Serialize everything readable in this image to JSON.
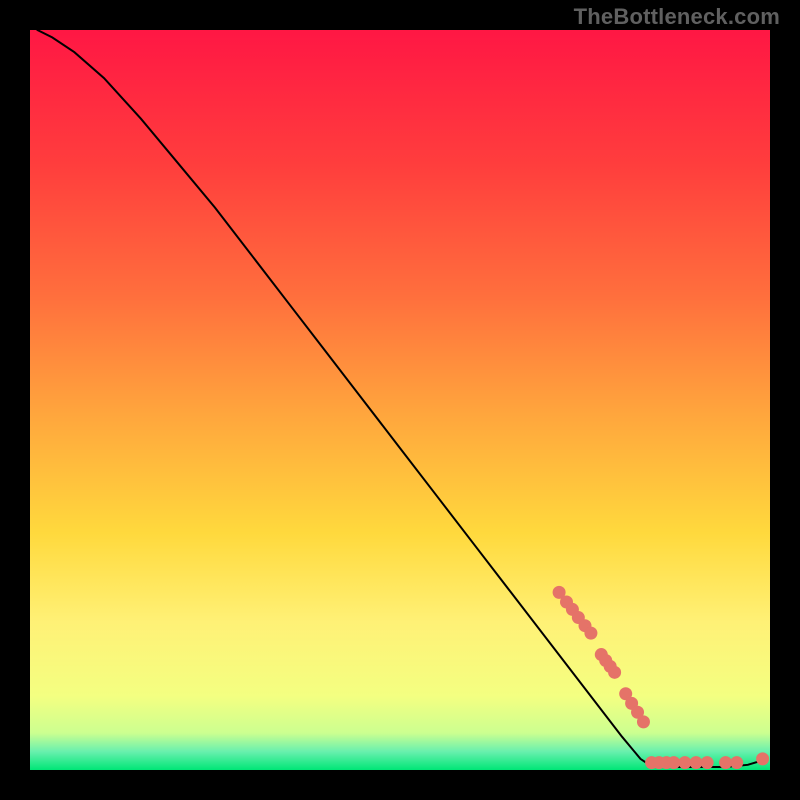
{
  "watermark": "TheBottleneck.com",
  "chart_data": {
    "type": "line",
    "title": "",
    "xlabel": "",
    "ylabel": "",
    "xlim": [
      0,
      100
    ],
    "ylim": [
      0,
      100
    ],
    "grid": false,
    "legend": false,
    "gradient_stops": [
      {
        "offset": 0.0,
        "color": "#ff1744"
      },
      {
        "offset": 0.18,
        "color": "#ff3d3d"
      },
      {
        "offset": 0.36,
        "color": "#ff6f3d"
      },
      {
        "offset": 0.52,
        "color": "#ffa63d"
      },
      {
        "offset": 0.68,
        "color": "#ffd93d"
      },
      {
        "offset": 0.8,
        "color": "#fff176"
      },
      {
        "offset": 0.9,
        "color": "#f4ff81"
      },
      {
        "offset": 0.95,
        "color": "#ccff90"
      },
      {
        "offset": 0.975,
        "color": "#69f0ae"
      },
      {
        "offset": 1.0,
        "color": "#00e676"
      }
    ],
    "series": [
      {
        "name": "curve",
        "type": "line",
        "style": "black-thin",
        "points": [
          {
            "x": 1.0,
            "y": 100.0
          },
          {
            "x": 3.0,
            "y": 99.0
          },
          {
            "x": 6.0,
            "y": 97.0
          },
          {
            "x": 10.0,
            "y": 93.5
          },
          {
            "x": 15.0,
            "y": 88.0
          },
          {
            "x": 20.0,
            "y": 82.0
          },
          {
            "x": 25.0,
            "y": 76.0
          },
          {
            "x": 30.0,
            "y": 69.5
          },
          {
            "x": 35.0,
            "y": 63.0
          },
          {
            "x": 40.0,
            "y": 56.5
          },
          {
            "x": 45.0,
            "y": 50.0
          },
          {
            "x": 50.0,
            "y": 43.5
          },
          {
            "x": 55.0,
            "y": 37.0
          },
          {
            "x": 60.0,
            "y": 30.5
          },
          {
            "x": 65.0,
            "y": 24.0
          },
          {
            "x": 70.0,
            "y": 17.5
          },
          {
            "x": 75.0,
            "y": 11.0
          },
          {
            "x": 80.0,
            "y": 4.5
          },
          {
            "x": 82.5,
            "y": 1.5
          },
          {
            "x": 84.0,
            "y": 0.5
          },
          {
            "x": 86.0,
            "y": 0.4
          },
          {
            "x": 90.0,
            "y": 0.4
          },
          {
            "x": 94.0,
            "y": 0.4
          },
          {
            "x": 97.0,
            "y": 0.7
          },
          {
            "x": 99.0,
            "y": 1.3
          }
        ]
      },
      {
        "name": "highlight-dots",
        "type": "scatter",
        "style": "coral-dot",
        "points": [
          {
            "x": 71.5,
            "y": 24.0
          },
          {
            "x": 72.5,
            "y": 22.7
          },
          {
            "x": 73.3,
            "y": 21.7
          },
          {
            "x": 74.1,
            "y": 20.6
          },
          {
            "x": 75.0,
            "y": 19.5
          },
          {
            "x": 75.8,
            "y": 18.5
          },
          {
            "x": 77.2,
            "y": 15.6
          },
          {
            "x": 77.8,
            "y": 14.8
          },
          {
            "x": 78.4,
            "y": 14.0
          },
          {
            "x": 79.0,
            "y": 13.2
          },
          {
            "x": 80.5,
            "y": 10.3
          },
          {
            "x": 81.3,
            "y": 9.0
          },
          {
            "x": 82.1,
            "y": 7.8
          },
          {
            "x": 82.9,
            "y": 6.5
          },
          {
            "x": 84.0,
            "y": 1.0
          },
          {
            "x": 85.0,
            "y": 1.0
          },
          {
            "x": 86.0,
            "y": 1.0
          },
          {
            "x": 87.0,
            "y": 1.0
          },
          {
            "x": 88.5,
            "y": 1.0
          },
          {
            "x": 90.0,
            "y": 1.0
          },
          {
            "x": 91.5,
            "y": 1.0
          },
          {
            "x": 94.0,
            "y": 1.0
          },
          {
            "x": 95.5,
            "y": 1.0
          },
          {
            "x": 99.0,
            "y": 1.5
          }
        ]
      }
    ]
  }
}
